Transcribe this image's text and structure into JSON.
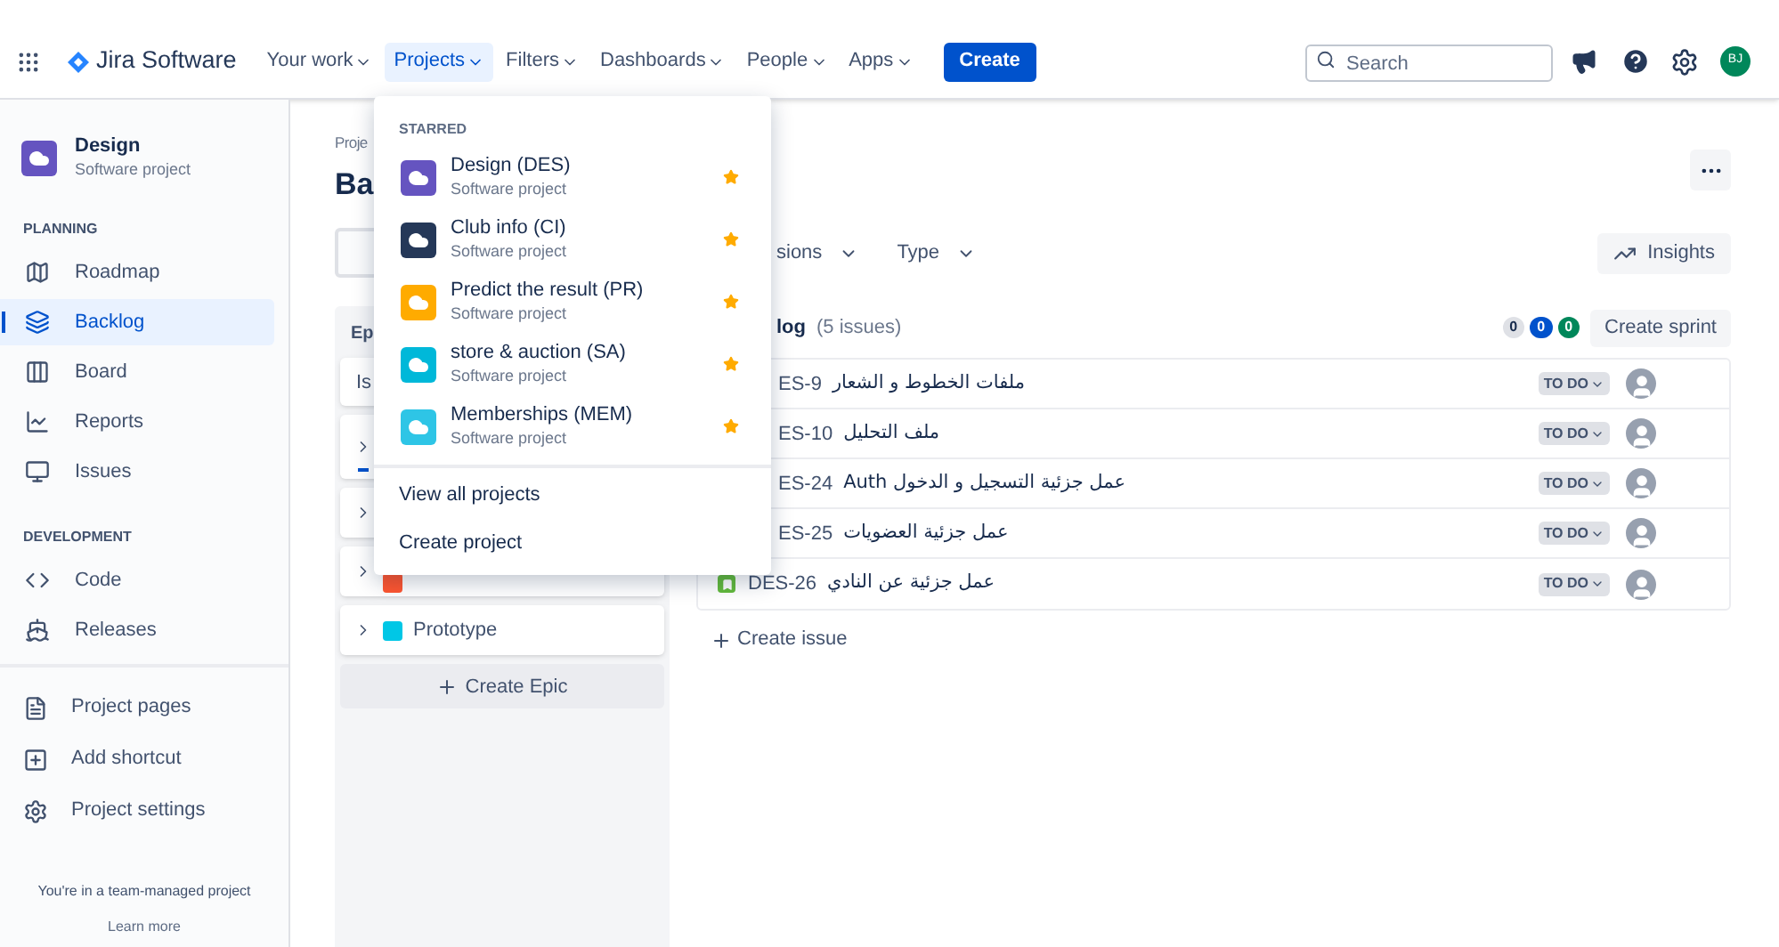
{
  "nav": {
    "product": "Jira Software",
    "items": [
      {
        "label": "Your work",
        "selected": false
      },
      {
        "label": "Projects",
        "selected": true
      },
      {
        "label": "Filters",
        "selected": false
      },
      {
        "label": "Dashboards",
        "selected": false
      },
      {
        "label": "People",
        "selected": false
      },
      {
        "label": "Apps",
        "selected": false
      }
    ],
    "create": "Create",
    "search": {
      "placeholder": "Search"
    },
    "avatar": "BJ"
  },
  "sidebar": {
    "project": {
      "name": "Design",
      "type": "Software project"
    },
    "sections": [
      {
        "title": "PLANNING",
        "items": [
          {
            "label": "Roadmap",
            "selected": false
          },
          {
            "label": "Backlog",
            "selected": true
          },
          {
            "label": "Board",
            "selected": false
          },
          {
            "label": "Reports",
            "selected": false
          },
          {
            "label": "Issues",
            "selected": false
          }
        ]
      },
      {
        "title": "DEVELOPMENT",
        "items": [
          {
            "label": "Code",
            "selected": false
          },
          {
            "label": "Releases",
            "selected": false
          }
        ]
      }
    ],
    "extra": [
      {
        "label": "Project pages"
      },
      {
        "label": "Add shortcut"
      },
      {
        "label": "Project settings"
      }
    ],
    "footer": {
      "text": "You're in a team-managed project",
      "link": "Learn more"
    }
  },
  "page": {
    "breadcrumb": "Proje",
    "title": "Ba",
    "filters": [
      {
        "label": "sions"
      },
      {
        "label": "Type"
      }
    ],
    "insights": "Insights"
  },
  "epics": {
    "header": "Ep",
    "issues_row": "Is",
    "items": [
      {
        "expanded": false,
        "progress": true
      },
      {
        "expanded": false,
        "progress": false
      },
      {
        "expanded": false,
        "progress": false,
        "color": "#ff5630"
      },
      {
        "expanded": false,
        "progress": false,
        "name": "Prototype",
        "color": "#00c7e6"
      }
    ],
    "create": "Create Epic"
  },
  "backlog": {
    "title": "log",
    "count": "(5 issues)",
    "counters": [
      {
        "value": "0",
        "color": "#dfe1e6"
      },
      {
        "value": "0",
        "color": "#0052cc"
      },
      {
        "value": "0",
        "color": "#00875a"
      }
    ],
    "create_sprint": "Create sprint",
    "issues": [
      {
        "key": "ES-9",
        "summary": "ملفات الخطوط و الشعار",
        "status": "TO DO",
        "type_icon": false
      },
      {
        "key": "ES-10",
        "summary": "ملف التحليل",
        "status": "TO DO",
        "type_icon": false
      },
      {
        "key": "ES-24",
        "summary": "عمل جزئية التسجيل و الدخول Auth",
        "status": "TO DO",
        "type_icon": false
      },
      {
        "key": "ES-25",
        "summary": "عمل جزئية العضويات",
        "status": "TO DO",
        "type_icon": false
      },
      {
        "key": "DES-26",
        "summary": "عمل جزئية عن النادي",
        "status": "TO DO",
        "type_icon": true
      }
    ],
    "create_issue": "Create issue"
  },
  "dropdown": {
    "section": "STARRED",
    "projects": [
      {
        "name": "Design (DES)",
        "type": "Software project",
        "color": "#6554c0",
        "starred": true
      },
      {
        "name": "Club info (CI)",
        "type": "Software project",
        "color": "#253858",
        "starred": true
      },
      {
        "name": "Predict the result (PR)",
        "type": "Software project",
        "color": "#ffab00",
        "starred": true
      },
      {
        "name": "store & auction (SA)",
        "type": "Software project",
        "color": "#00b8d9",
        "starred": true
      },
      {
        "name": "Memberships (MEM)",
        "type": "Software project",
        "color": "#2ec5e6",
        "starred": true
      }
    ],
    "actions": [
      "View all projects",
      "Create project"
    ]
  }
}
